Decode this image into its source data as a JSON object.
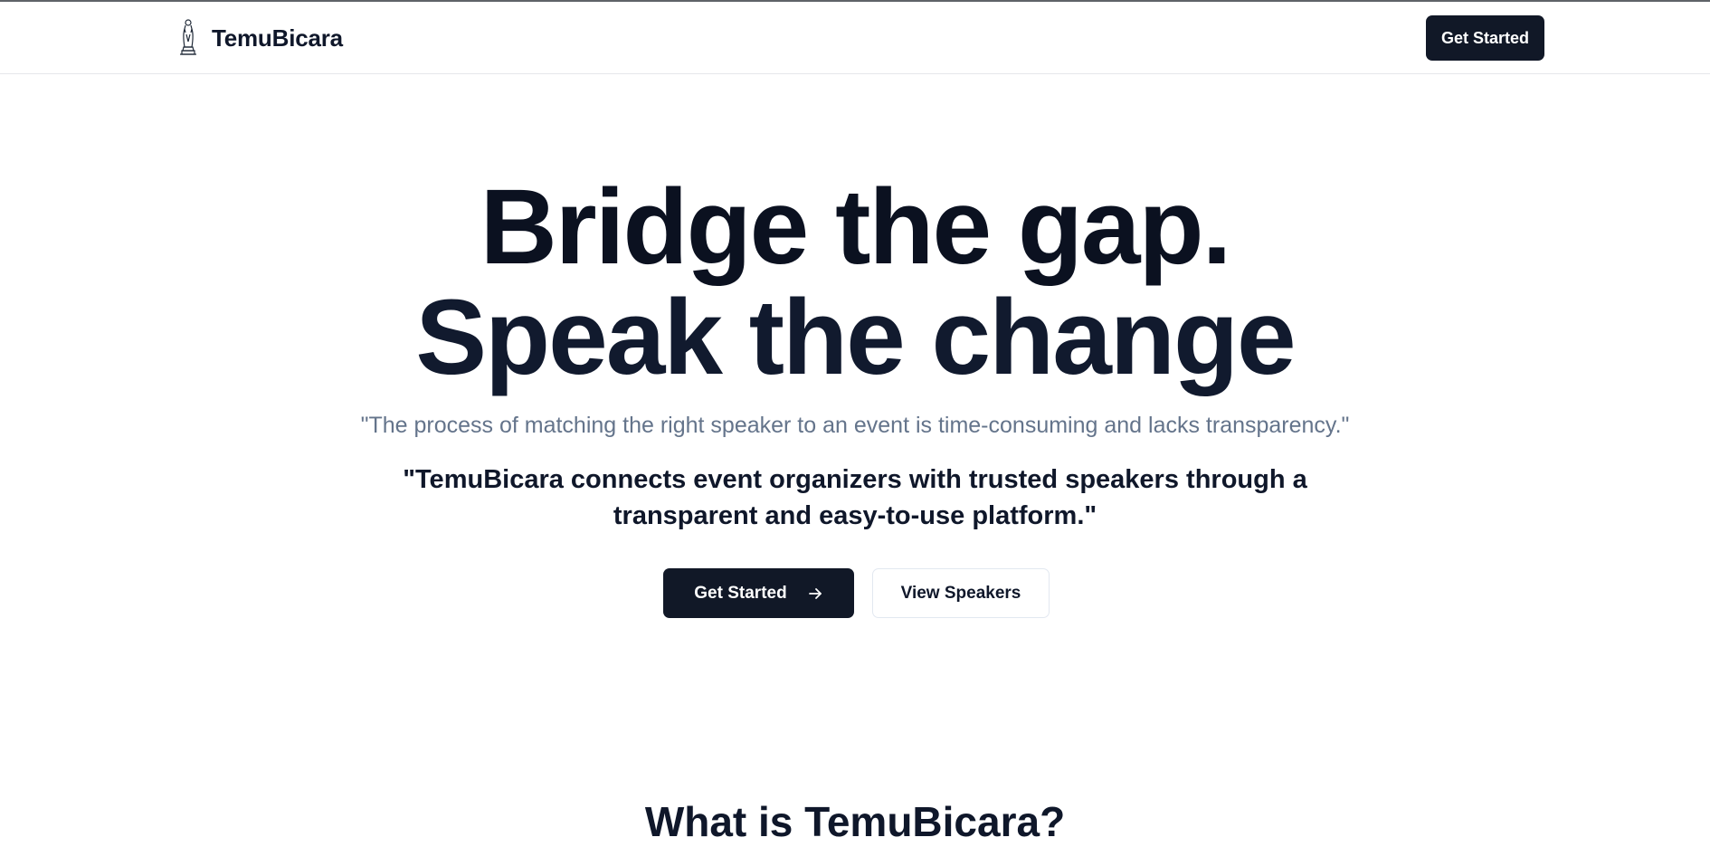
{
  "brand": {
    "name": "TemuBicara",
    "logo_icon": "statue-logo-icon"
  },
  "nav": {
    "cta_label": "Get Started"
  },
  "hero": {
    "headline_line1": "Bridge the gap.",
    "headline_line2": "Speak the change",
    "quote": "\"The process of matching the right speaker to an event is time-consuming and lacks transparency.\"",
    "lead": "\"TemuBicara connects event organizers with trusted speakers through a transparent and easy-to-use platform.\"",
    "primary_button_label": "Get Started",
    "primary_button_icon": "arrow-right-icon",
    "secondary_button_label": "View Speakers"
  },
  "about": {
    "title": "What is TemuBicara?"
  },
  "colors": {
    "primary": "#111827",
    "heading": "#0b1120",
    "muted": "#64748b",
    "border": "#e2e8f0"
  }
}
